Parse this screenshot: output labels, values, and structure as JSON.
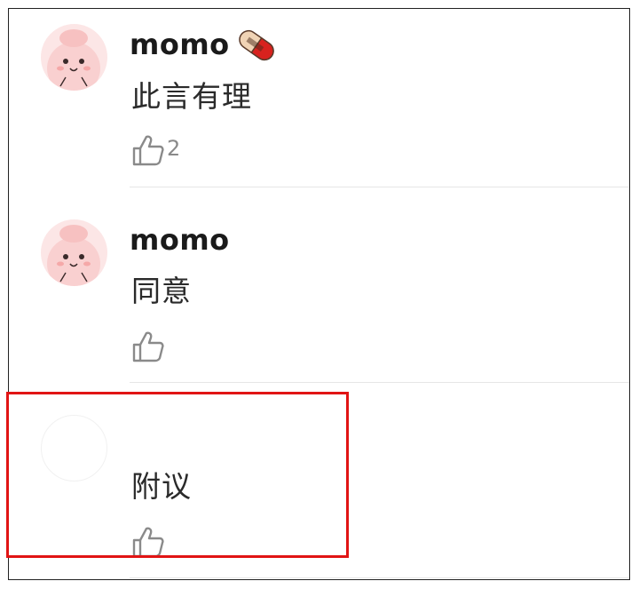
{
  "comments": [
    {
      "username": "momo",
      "text": "此言有理",
      "like_count": "2",
      "badge_icon": "pill-badge-icon",
      "avatar_icon": "pink-blob-avatar-icon"
    },
    {
      "username": "momo",
      "text": "同意",
      "like_count": "",
      "avatar_icon": "pink-blob-avatar-icon"
    },
    {
      "username": "",
      "text": "附议",
      "like_count": "",
      "avatar_icon": "blank-avatar"
    }
  ],
  "colors": {
    "highlight_border": "#e11414",
    "divider": "#e6e6e6",
    "like_icon": "#8a8a8a",
    "avatar_bg": "#fbd7d7"
  }
}
